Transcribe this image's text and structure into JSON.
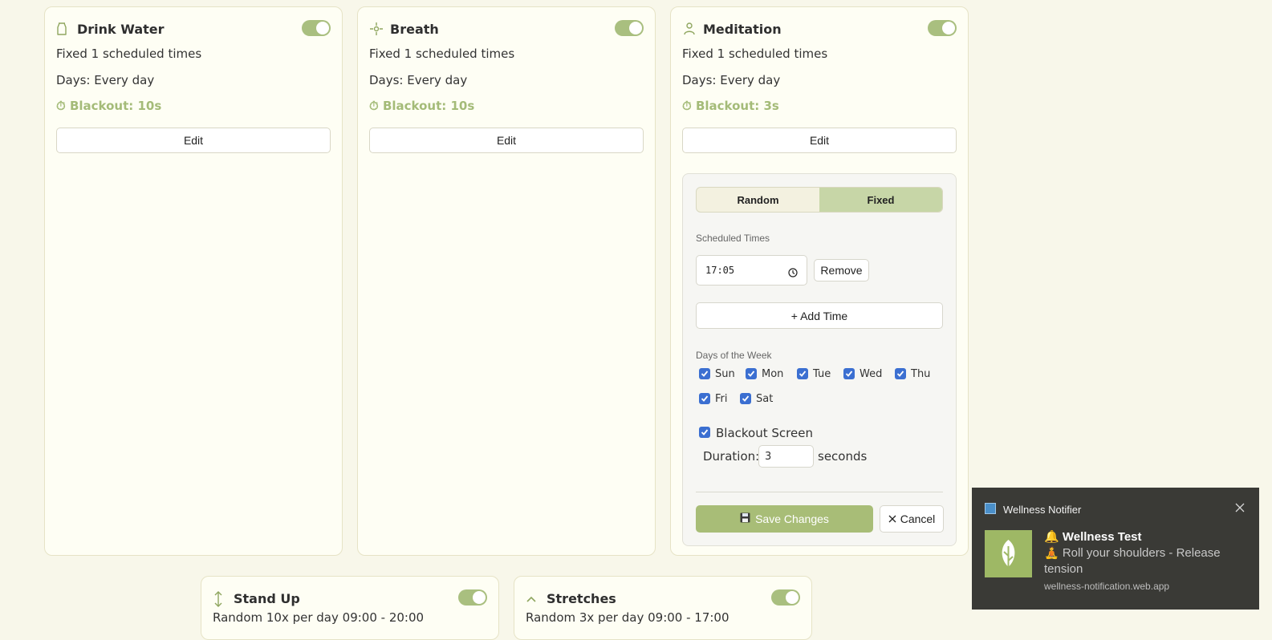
{
  "cards": [
    {
      "title": "Drink Water",
      "icon": "water-drop-icon",
      "mode": "Fixed 1 scheduled times",
      "days": "Days: Every day",
      "blackout": "Blackout: 10s",
      "edit_label": "Edit",
      "enabled": true
    },
    {
      "title": "Breath",
      "icon": "breath-icon",
      "mode": "Fixed 1 scheduled times",
      "days": "Days: Every day",
      "blackout": "Blackout: 10s",
      "edit_label": "Edit",
      "enabled": true
    },
    {
      "title": "Meditation",
      "icon": "person-icon",
      "mode": "Fixed 1 scheduled times",
      "days": "Days: Every day",
      "blackout": "Blackout: 3s",
      "edit_label": "Edit",
      "enabled": true
    },
    {
      "title": "Stand Up",
      "icon": "vertical-arrows-icon",
      "mode": "Random 10x per day 09:00 - 20:00",
      "enabled": true
    },
    {
      "title": "Stretches",
      "icon": "chevron-up-icon",
      "mode": "Random 3x per day 09:00 - 17:00",
      "enabled": true
    }
  ],
  "editor": {
    "segment": {
      "random": "Random",
      "fixed": "Fixed",
      "selected": "Fixed"
    },
    "scheduled_label": "Scheduled Times",
    "time_value": "17:05",
    "remove_label": "Remove",
    "add_time_label": "+ Add Time",
    "days_label": "Days of the Week",
    "days": [
      {
        "label": "Sun",
        "checked": true
      },
      {
        "label": "Mon",
        "checked": true
      },
      {
        "label": "Tue",
        "checked": true
      },
      {
        "label": "Wed",
        "checked": true
      },
      {
        "label": "Thu",
        "checked": true
      },
      {
        "label": "Fri",
        "checked": true
      },
      {
        "label": "Sat",
        "checked": true
      }
    ],
    "blackout_label": "Blackout Screen",
    "blackout_checked": true,
    "duration_label": "Duration:",
    "duration_value": "3",
    "duration_unit": "seconds",
    "save_label": "Save Changes",
    "cancel_label": "Cancel"
  },
  "notification": {
    "app_name": "Wellness Notifier",
    "title": "🔔 Wellness Test",
    "body": "🧘 Roll your shoulders - Release tension",
    "source": "wellness-notification.web.app"
  },
  "colors": {
    "accent": "#a8bd77",
    "background": "#f8f7ea",
    "card": "#fefef4",
    "checkbox": "#3b6fd1"
  }
}
